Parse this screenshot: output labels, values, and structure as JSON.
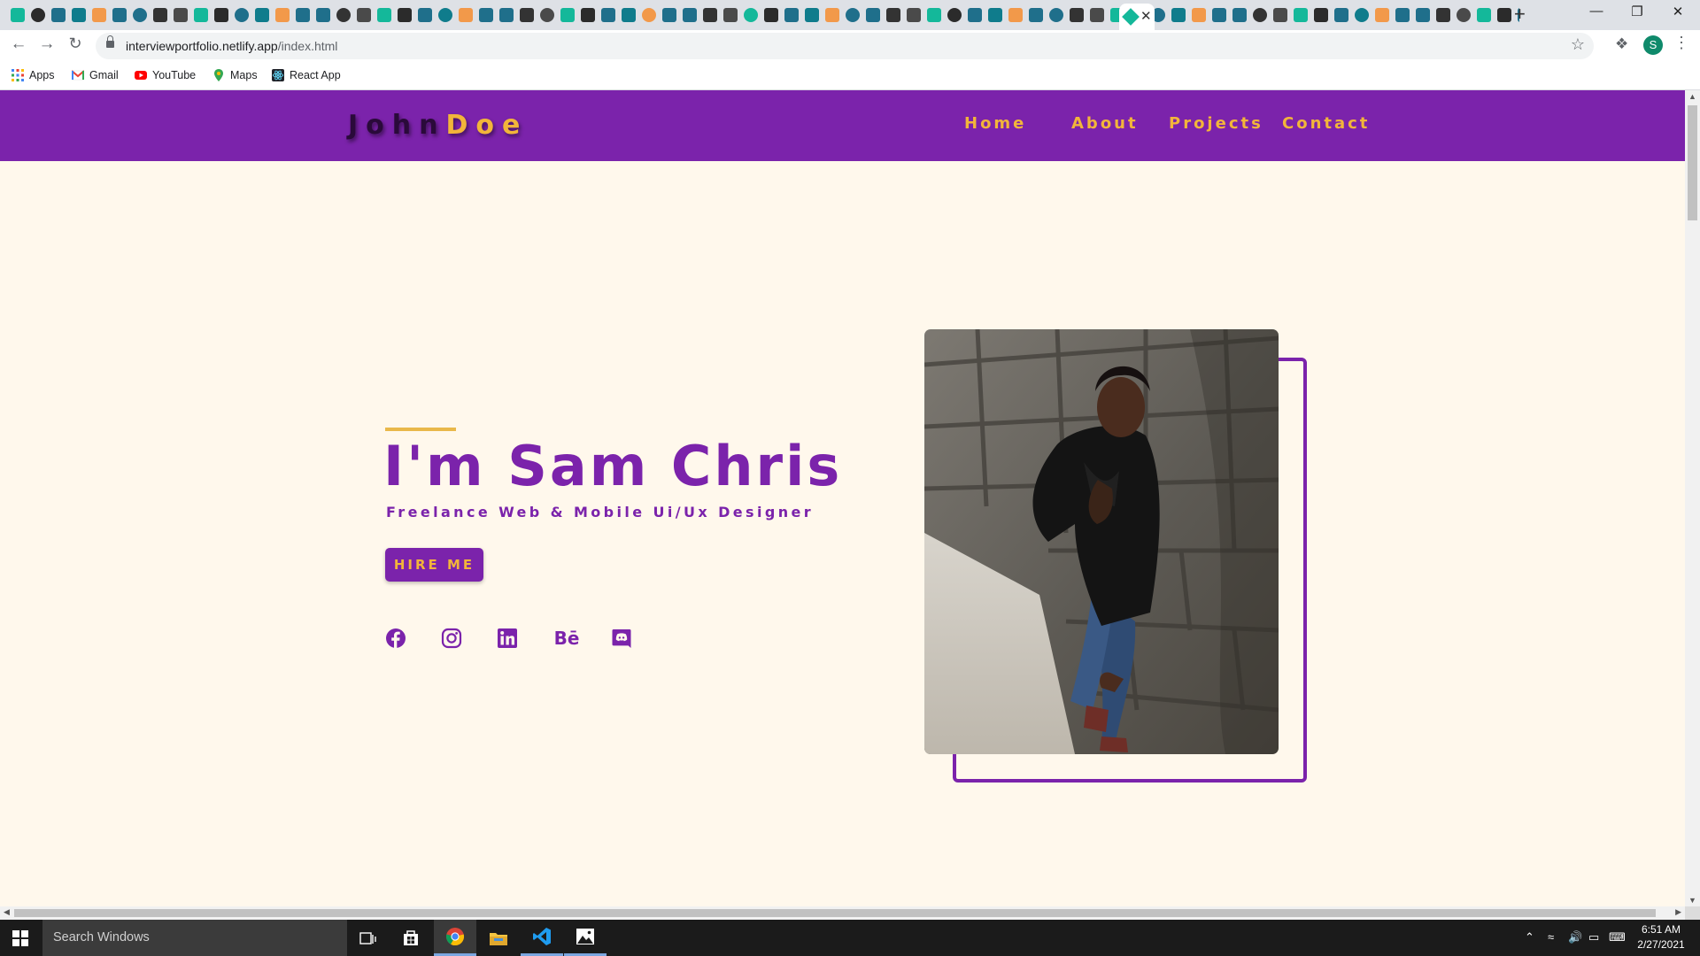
{
  "browser": {
    "tab_close": "✕",
    "new_tab": "+",
    "window_controls": {
      "minimize": "—",
      "restore": "❐",
      "close": "✕"
    },
    "address": {
      "domain": "interviewportfolio.netlify.app",
      "path": "/index.html"
    },
    "profile_initial": "S",
    "bookmarks": [
      {
        "label": "Apps",
        "icon": "apps-grid-icon"
      },
      {
        "label": "Gmail",
        "icon": "gmail-icon"
      },
      {
        "label": "YouTube",
        "icon": "youtube-icon"
      },
      {
        "label": "Maps",
        "icon": "maps-pin-icon"
      },
      {
        "label": "React App",
        "icon": "react-icon"
      }
    ]
  },
  "site": {
    "logo": {
      "first": "John",
      "last": "Doe"
    },
    "nav": [
      "Home",
      "About",
      "Projects",
      "Contact"
    ],
    "hero": {
      "name": "I'm Sam Chris",
      "role": "Freelance Web & Mobile Ui/Ux Designer",
      "cta": "HIRE ME",
      "social": [
        {
          "icon": "facebook-icon"
        },
        {
          "icon": "instagram-icon"
        },
        {
          "icon": "linkedin-icon"
        },
        {
          "icon": "behance-icon",
          "glyph": "Bē"
        },
        {
          "icon": "discord-icon"
        }
      ]
    },
    "colors": {
      "primary": "#7b23ab",
      "accent": "#f2b53a",
      "background": "#fff8ec"
    }
  },
  "taskbar": {
    "search_placeholder": "Search Windows",
    "time": "6:51 AM",
    "date": "2/27/2021"
  }
}
